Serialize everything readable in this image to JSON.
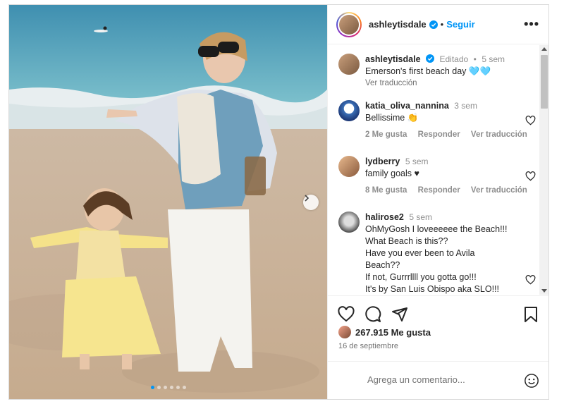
{
  "post": {
    "username": "ashleytisdale",
    "separator": "•",
    "follow_label": "Seguir",
    "more_label": "•••",
    "carousel": {
      "slides": 6,
      "active": 0
    }
  },
  "caption": {
    "username": "ashleytisdale",
    "edited": "Editado",
    "separator": "•",
    "time": "5 sem",
    "text": "Emerson's first beach day 🩵🩵",
    "translate": "Ver traducción"
  },
  "comments": [
    {
      "username": "katia_oliva_nannina",
      "time": "3 sem",
      "text": "Bellissime 👏",
      "likes": "2 Me gusta",
      "reply": "Responder",
      "translate": "Ver traducción"
    },
    {
      "username": "lydberry",
      "time": "5 sem",
      "text": "family goals ♥",
      "likes": "8 Me gusta",
      "reply": "Responder",
      "translate": "Ver traducción"
    },
    {
      "username": "halirose2",
      "time": "5 sem",
      "lines": [
        "OhMyGosh I loveeeeee the Beach!!!",
        "What Beach is this??",
        "Have you ever been to Avila",
        "Beach??",
        "If not, Gurrrllll you gotta go!!!",
        "It's by San Luis Obispo aka SLO!!!"
      ]
    }
  ],
  "likes_count": "267.915 Me gusta",
  "date": "16 de septiembre",
  "comment_placeholder": "Agrega un comentario...",
  "icons": [
    "verified-badge-icon",
    "more-options-icon",
    "heart-icon",
    "comment-icon",
    "share-icon",
    "bookmark-icon",
    "emoji-icon",
    "chevron-right-icon"
  ],
  "colors": {
    "accent": "#0095f6",
    "text": "#262626",
    "muted": "#8e8e8e"
  }
}
